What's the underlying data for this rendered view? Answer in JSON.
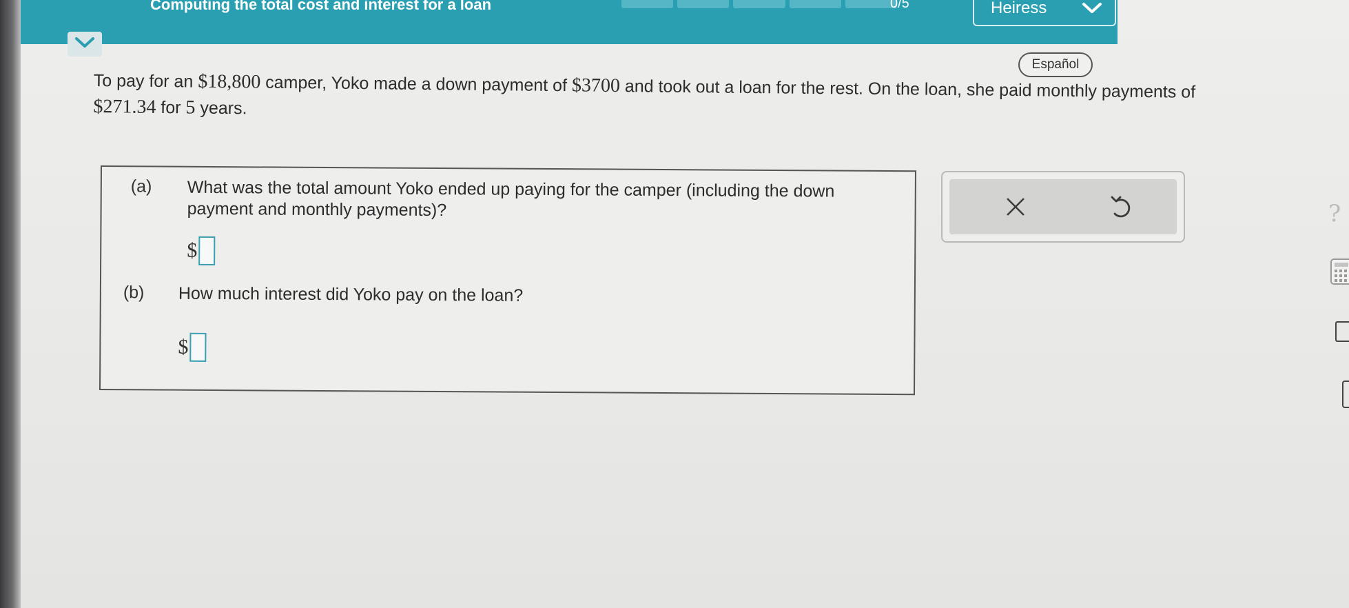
{
  "header": {
    "title": "Computing the total cost and interest for a loan",
    "progress_label": "0/5",
    "progress_segments": 5,
    "progress_completed": 0,
    "user_name": "Heiress",
    "accent_color": "#2a9fb1"
  },
  "language_button": "Español",
  "problem": {
    "t1": "To pay for an ",
    "v1": "$18,800",
    "t2": " camper, Yoko made a down payment of ",
    "v2": "$3700",
    "t3": " and took out a loan for the rest. On the loan, she paid monthly payments of ",
    "v3": "$271.34",
    "t4": " for ",
    "v4": "5",
    "t5": " years."
  },
  "parts": [
    {
      "label": "(a)",
      "question": "What was the total amount Yoko ended up paying for the camper (including the down payment and monthly payments)?",
      "currency": "$",
      "answer": ""
    },
    {
      "label": "(b)",
      "question": "How much interest did Yoko pay on the loan?",
      "currency": "$",
      "answer": ""
    }
  ],
  "actions": {
    "clear_icon": "x-icon",
    "undo_icon": "undo-icon"
  },
  "side_tools": {
    "help_label": "?",
    "help_icon": "question-icon",
    "calculator_icon": "calculator-icon"
  }
}
